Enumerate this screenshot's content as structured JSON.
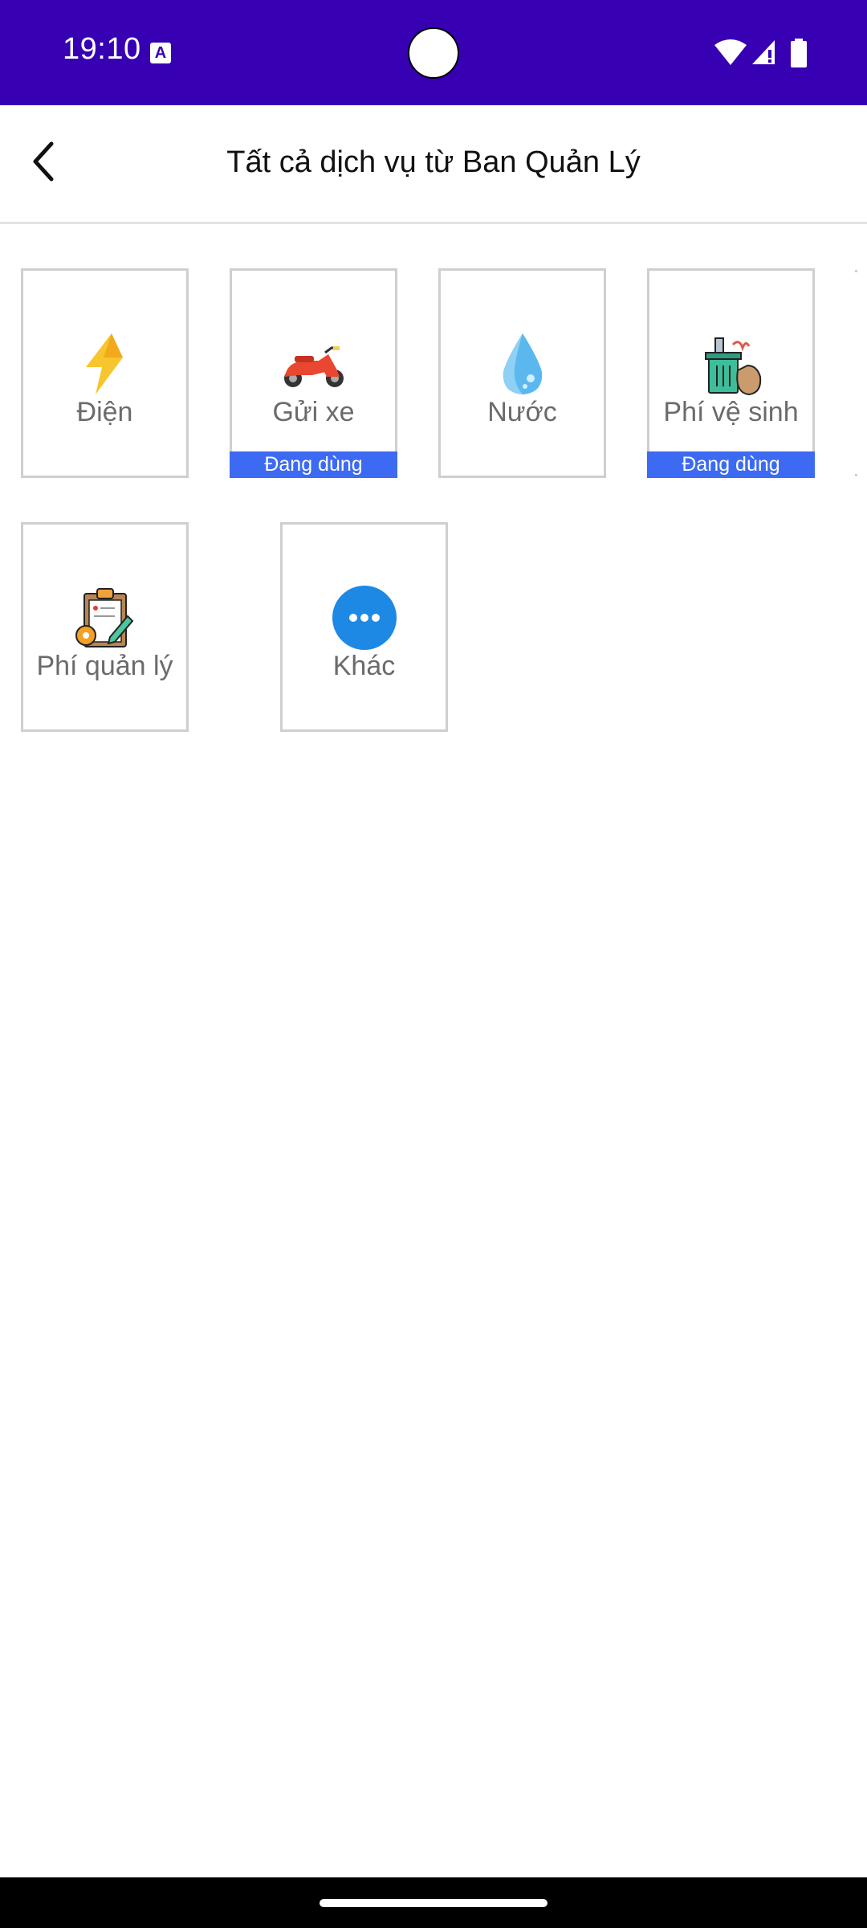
{
  "status_bar": {
    "time": "19:10",
    "keyboard_icon_letter": "A"
  },
  "app_bar": {
    "title": "Tất cả dịch vụ từ Ban Quản Lý",
    "back_icon": "chevron-left-icon"
  },
  "services": [
    {
      "label": "Điện",
      "icon": "lightning-icon",
      "badge": ""
    },
    {
      "label": "Gửi xe",
      "icon": "scooter-icon",
      "badge": "Đang dùng"
    },
    {
      "label": "Nước",
      "icon": "water-drop-icon",
      "badge": ""
    },
    {
      "label": "Phí vệ sinh",
      "icon": "trash-bin-icon",
      "badge": "Đang dùng"
    },
    {
      "label": "Phí quản lý",
      "icon": "clipboard-icon",
      "badge": ""
    },
    {
      "label": "Khác",
      "icon": "more-icon",
      "badge": ""
    }
  ],
  "colors": {
    "status_bar": "#3700b3",
    "badge": "#3d6af2",
    "more_button": "#1e88e5"
  }
}
